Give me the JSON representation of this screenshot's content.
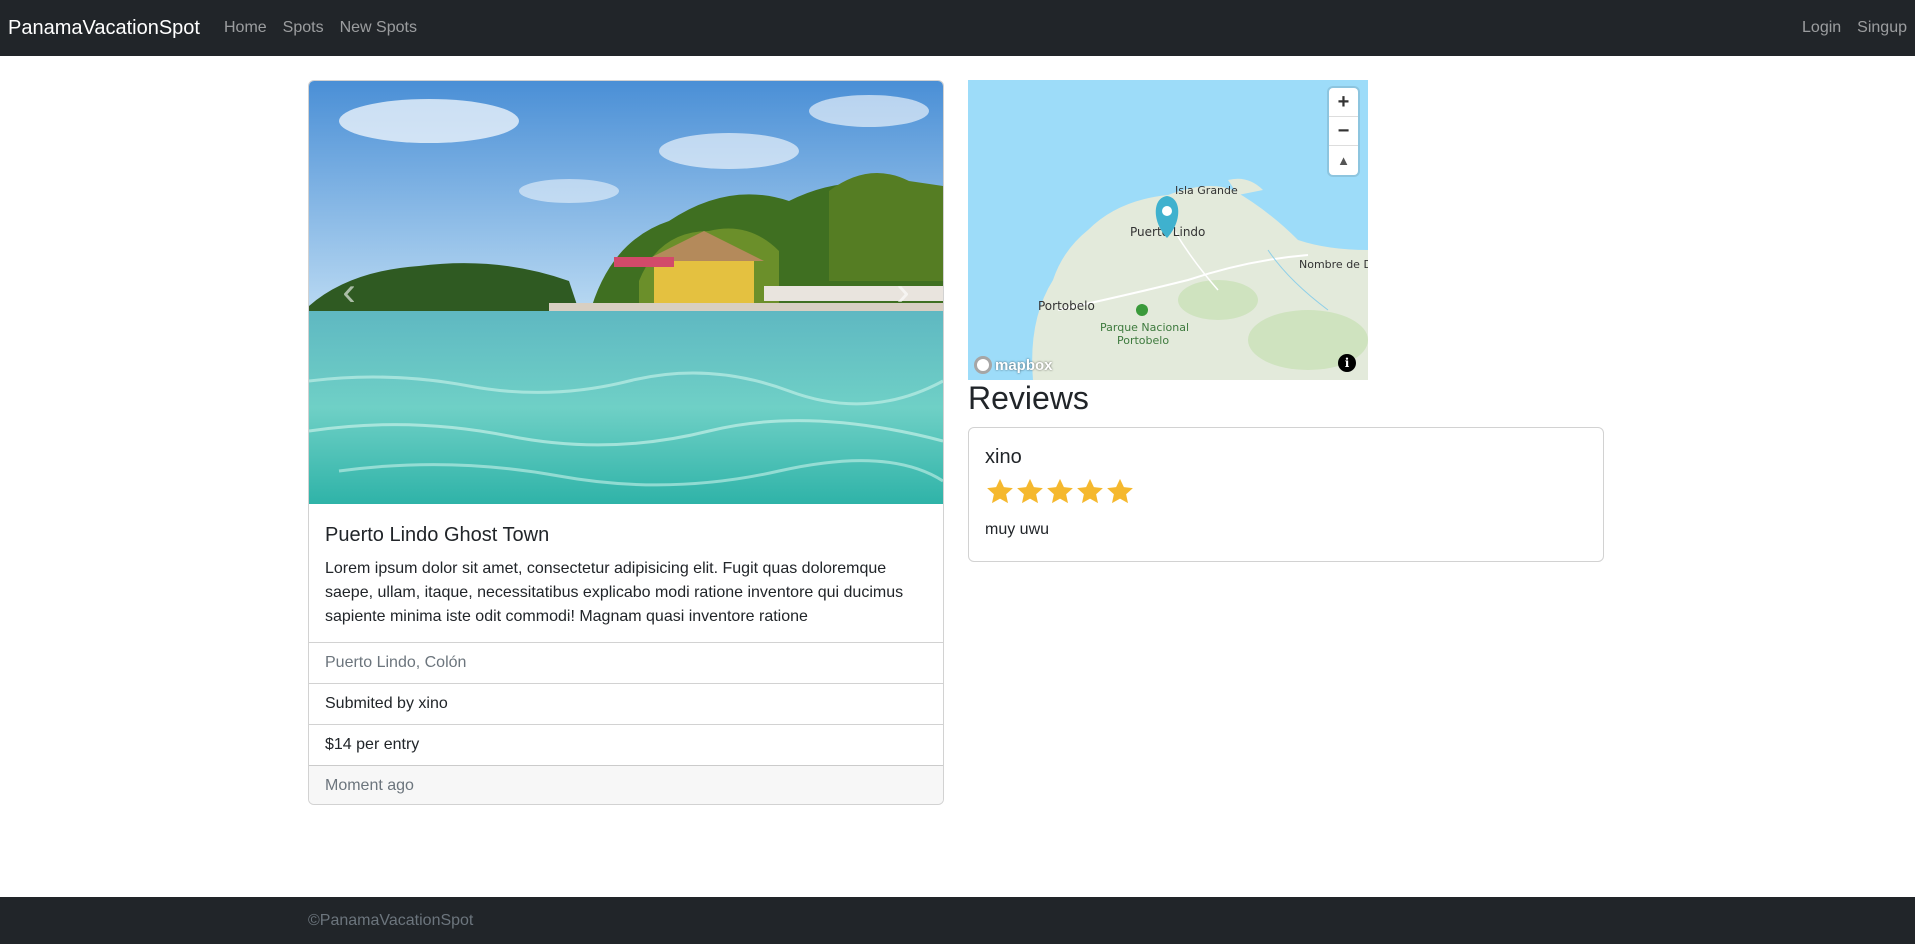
{
  "navbar": {
    "brand": "PanamaVacationSpot",
    "links": [
      "Home",
      "Spots",
      "New Spots"
    ],
    "right_links": [
      "Login",
      "Singup"
    ]
  },
  "spot": {
    "title": "Puerto Lindo Ghost Town",
    "description": "Lorem ipsum dolor sit amet, consectetur adipisicing elit. Fugit quas doloremque saepe, ullam, itaque, necessitatibus explicabo modi ratione inventore qui ducimus sapiente minima iste odit commodi! Magnam quasi inventore ratione",
    "location": "Puerto Lindo, Colón",
    "submitted_by": "Submited by xino",
    "price": "$14 per entry",
    "posted": "Moment ago",
    "carousel": {
      "prev_icon": "‹",
      "next_icon": "›"
    }
  },
  "map": {
    "labels": {
      "isla_grande": "Isla Grande",
      "puerto_lindo": "Puerto Lindo",
      "nombre_de_dios": "Nombre de Di",
      "portobelo": "Portobelo",
      "parque_line1": "Parque Nacional",
      "parque_line2": "Portobelo"
    },
    "controls": {
      "zoom_in": "+",
      "zoom_out": "−",
      "compass": "▲"
    },
    "logo": "mapbox",
    "info": "i",
    "colors": {
      "water": "#9ddcf9",
      "land": "#e3eadb",
      "marker": "#3fb1ce"
    }
  },
  "reviews": {
    "heading": "Reviews",
    "items": [
      {
        "author": "xino",
        "rating": 5,
        "max_rating": 5,
        "text": "muy uwu"
      }
    ]
  },
  "footer": {
    "text": "©PanamaVacationSpot"
  }
}
